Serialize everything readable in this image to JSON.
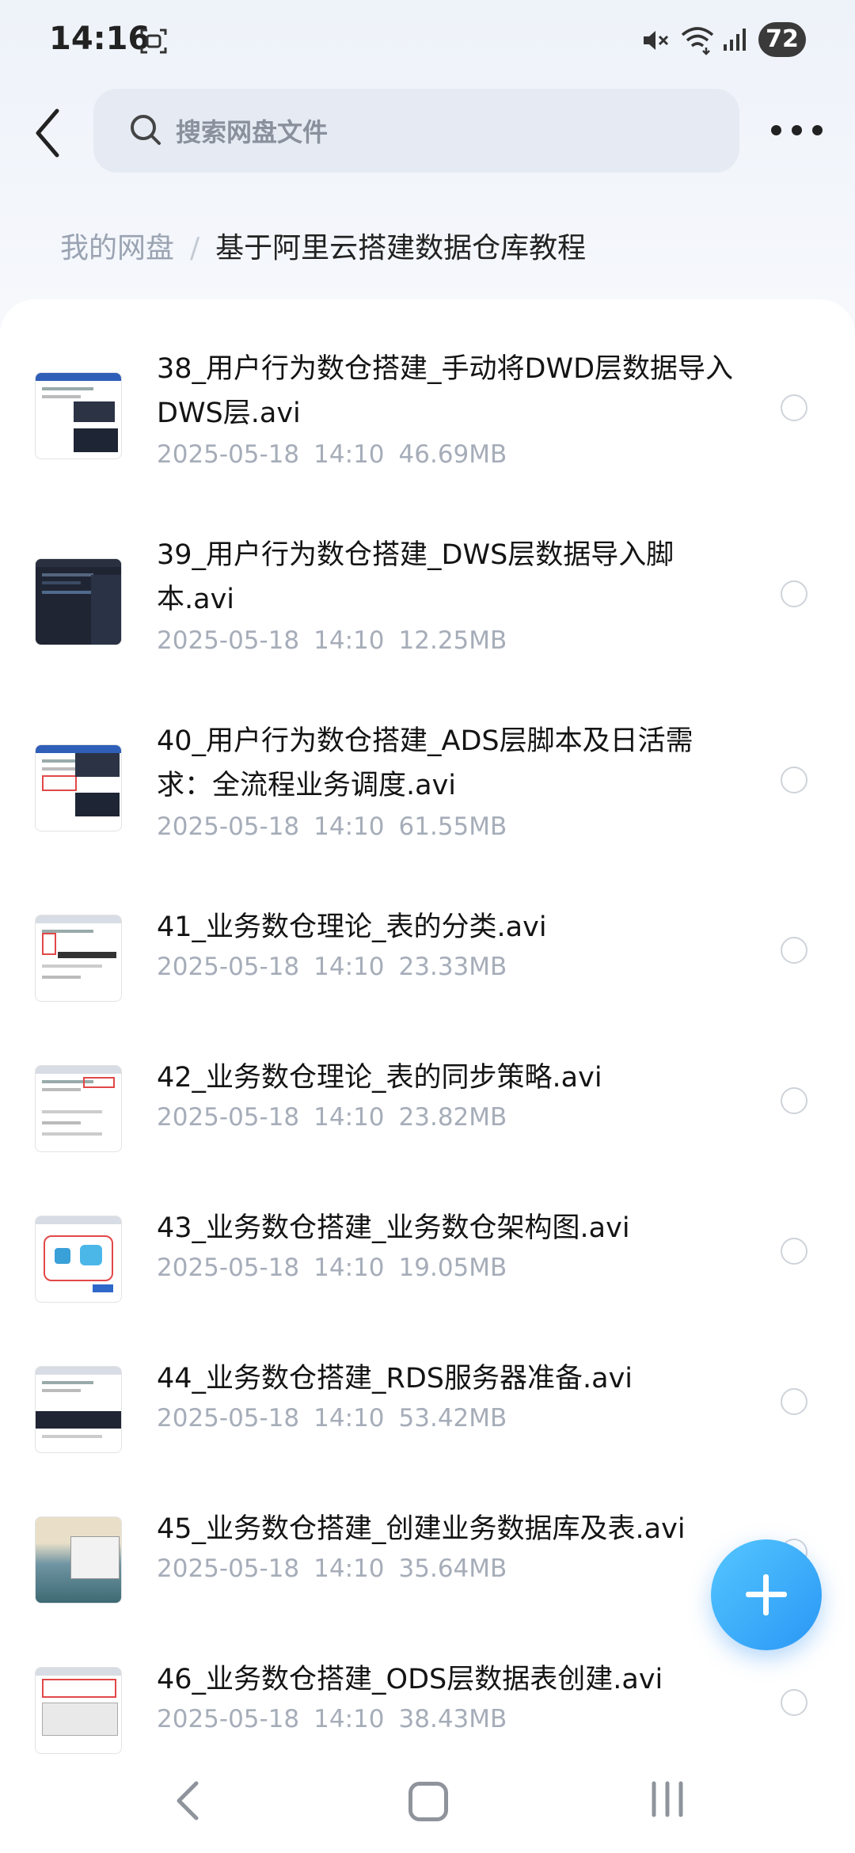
{
  "status": {
    "time": "14:16",
    "battery": "72"
  },
  "search": {
    "placeholder": "搜索网盘文件"
  },
  "breadcrumb": {
    "root": "我的网盘",
    "separator": "/",
    "current": "基于阿里云搭建数据仓库教程"
  },
  "files": [
    {
      "name": "38_用户行为数仓搭建_手动将DWD层数据导入DWS层.avi",
      "date": "2025-05-18",
      "time": "14:10",
      "size": "46.69MB",
      "thumb": "doc-dark"
    },
    {
      "name": "39_用户行为数仓搭建_DWS层数据导入脚本.avi",
      "date": "2025-05-18",
      "time": "14:10",
      "size": "12.25MB",
      "thumb": "code-dark"
    },
    {
      "name": "40_用户行为数仓搭建_ADS层脚本及日活需求：全流程业务调度.avi",
      "date": "2025-05-18",
      "time": "14:10",
      "size": "61.55MB",
      "thumb": "doc-red"
    },
    {
      "name": "41_业务数仓理论_表的分类.avi",
      "date": "2025-05-18",
      "time": "14:10",
      "size": "23.33MB",
      "thumb": "doc-table"
    },
    {
      "name": "42_业务数仓理论_表的同步策略.avi",
      "date": "2025-05-18",
      "time": "14:10",
      "size": "23.82MB",
      "thumb": "doc-text"
    },
    {
      "name": "43_业务数仓搭建_业务数仓架构图.avi",
      "date": "2025-05-18",
      "time": "14:10",
      "size": "19.05MB",
      "thumb": "doc-diagram"
    },
    {
      "name": "44_业务数仓搭建_RDS服务器准备.avi",
      "date": "2025-05-18",
      "time": "14:10",
      "size": "53.42MB",
      "thumb": "doc-dark-band"
    },
    {
      "name": "45_业务数仓搭建_创建业务数据库及表.avi",
      "date": "2025-05-18",
      "time": "14:10",
      "size": "35.64MB",
      "thumb": "beach"
    },
    {
      "name": "46_业务数仓搭建_ODS层数据表创建.avi",
      "date": "2025-05-18",
      "time": "14:10",
      "size": "38.43MB",
      "thumb": "doc-red-table"
    }
  ]
}
